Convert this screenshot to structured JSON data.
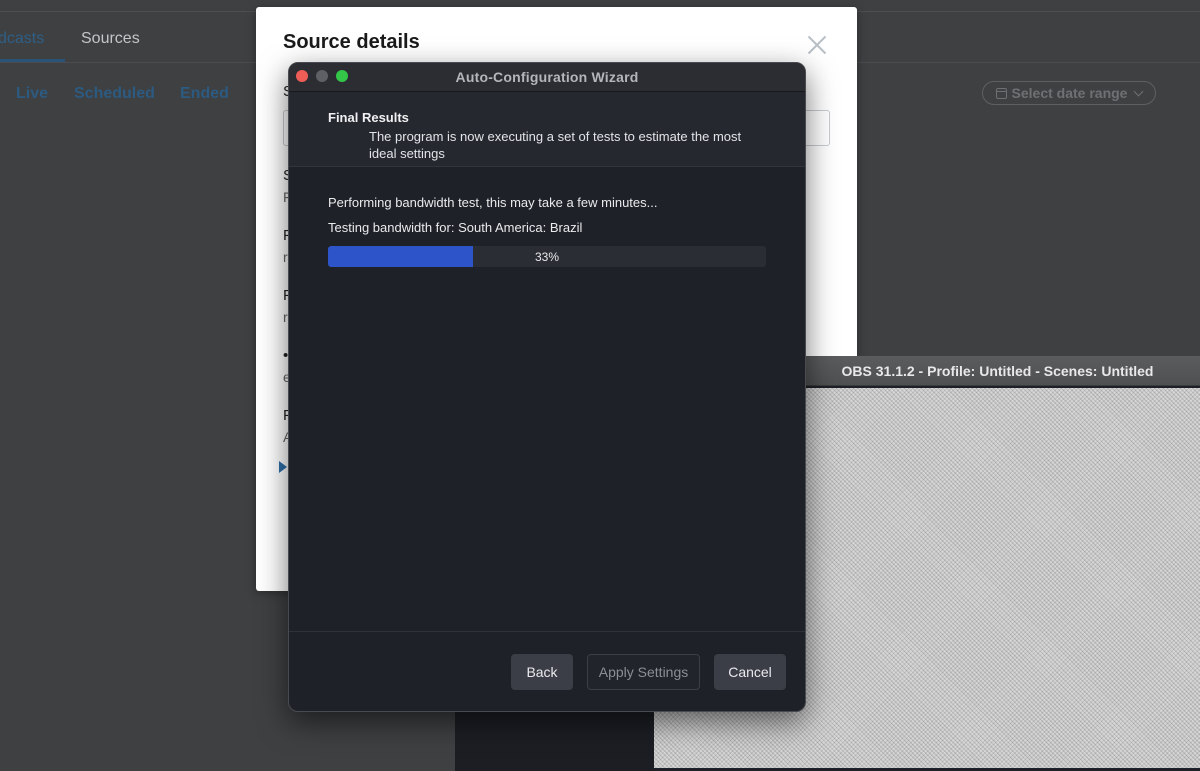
{
  "background_app": {
    "tabs": [
      {
        "label": "Broadcasts",
        "visible_label": "dcasts",
        "active": true
      },
      {
        "label": "Sources",
        "active": false
      }
    ],
    "filters": [
      "Live",
      "Scheduled",
      "Ended"
    ],
    "date_range": {
      "label": "Select date range",
      "icon": "calendar-icon"
    }
  },
  "source_modal": {
    "title": "Source details",
    "peek_letters": [
      "S",
      "S",
      "F",
      "F",
      "R",
      "F",
      "•",
      "e",
      "F",
      "A"
    ],
    "peek_sub_letters": [
      "F",
      "r",
      "r",
      "e",
      "A"
    ]
  },
  "obs_window": {
    "title": "OBS 31.1.2 - Profile: Untitled - Scenes: Untitled"
  },
  "wizard": {
    "title": "Auto-Configuration Wizard",
    "header_title": "Final Results",
    "header_description": "The program is now executing a set of tests to estimate the most ideal settings",
    "status_line": "Performing bandwidth test, this may take a few minutes...",
    "testing_line": "Testing bandwidth for: South America: Brazil",
    "progress": {
      "value": 33,
      "label": "33%"
    },
    "buttons": {
      "back": "Back",
      "apply": "Apply Settings",
      "cancel": "Cancel"
    },
    "colors": {
      "progress_fill": "#2d55c9",
      "close": "#ee5e56",
      "maximize": "#33c648"
    }
  }
}
